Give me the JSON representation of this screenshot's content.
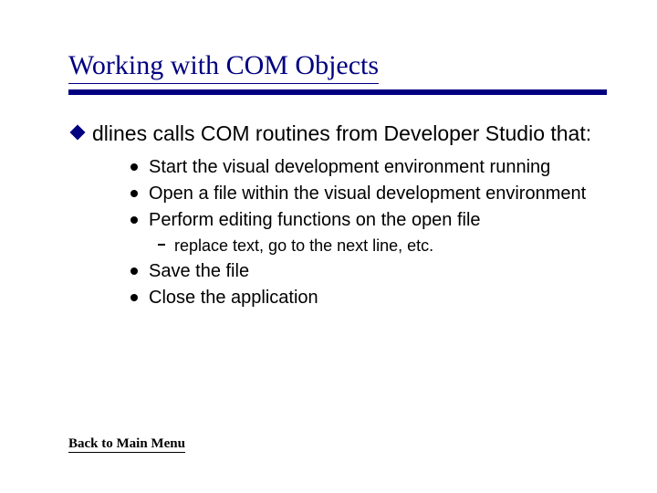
{
  "title": "Working with COM Objects",
  "bullets": {
    "main": "dlines calls COM routines from Developer Studio that:",
    "subs": [
      "Start the visual development environment running",
      "Open a file within the visual development environment",
      "Perform editing functions on the open file"
    ],
    "subsub": "replace text, go to the next line, etc.",
    "subs2": [
      "Save the file",
      "Close the application"
    ]
  },
  "back_link": "Back to Main Menu"
}
